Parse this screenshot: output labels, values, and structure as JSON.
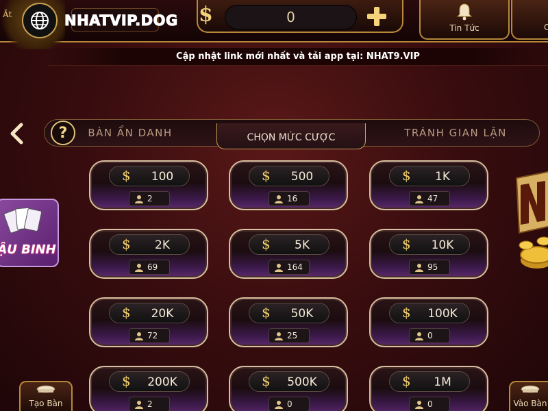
{
  "header": {
    "emblem_text": "Ăt",
    "site_label": "NHATVIP.DOG",
    "balance": "0",
    "news_label": "Tin Tức",
    "right_label": "C"
  },
  "banner": {
    "text": "Cập nhật link mới nhất và tải app tại: NHAT9.VIP"
  },
  "tabs": {
    "anon": "BÀN ẨN DANH",
    "bet_level": "CHỌN MỨC CƯỢC",
    "anti_cheat": "TRÁNH GIAN LẬN",
    "help": "?"
  },
  "side": {
    "left_game_label": "ẬU BINH"
  },
  "bets": [
    {
      "amount": "100",
      "players": "2"
    },
    {
      "amount": "500",
      "players": "16"
    },
    {
      "amount": "1K",
      "players": "47"
    },
    {
      "amount": "2K",
      "players": "69"
    },
    {
      "amount": "5K",
      "players": "164"
    },
    {
      "amount": "10K",
      "players": "95"
    },
    {
      "amount": "20K",
      "players": "72"
    },
    {
      "amount": "50K",
      "players": "25"
    },
    {
      "amount": "100K",
      "players": "0"
    },
    {
      "amount": "200K",
      "players": "2"
    },
    {
      "amount": "500K",
      "players": "0"
    },
    {
      "amount": "1M",
      "players": "0"
    }
  ],
  "currency_symbol": "$",
  "footer": {
    "create_label": "Tạo Bàn",
    "join_label": "Vào Bàn"
  },
  "colors": {
    "gold": "#c9a252",
    "background": "#3a0d0f",
    "card_purple": "#5a2a6a"
  }
}
